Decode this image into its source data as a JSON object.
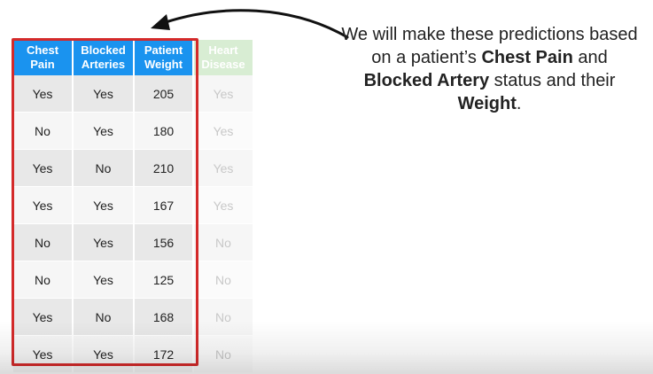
{
  "table": {
    "headers": [
      {
        "text": "Chest\nPain"
      },
      {
        "text": "Blocked\nArteries"
      },
      {
        "text": "Patient\nWeight"
      },
      {
        "text": "Heart\nDisease"
      }
    ],
    "rows": [
      [
        "Yes",
        "Yes",
        "205",
        "Yes"
      ],
      [
        "No",
        "Yes",
        "180",
        "Yes"
      ],
      [
        "Yes",
        "No",
        "210",
        "Yes"
      ],
      [
        "Yes",
        "Yes",
        "167",
        "Yes"
      ],
      [
        "No",
        "Yes",
        "156",
        "No"
      ],
      [
        "No",
        "Yes",
        "125",
        "No"
      ],
      [
        "Yes",
        "No",
        "168",
        "No"
      ],
      [
        "Yes",
        "Yes",
        "172",
        "No"
      ]
    ]
  },
  "caption": {
    "p1": "We will make these predictions based on a patient’s ",
    "b1": "Chest Pain",
    "p2": " and ",
    "b2": "Blocked Artery",
    "p3": " status and their ",
    "b3": "Weight",
    "p4": "."
  },
  "colors": {
    "header_blue": "#1a93ef",
    "header_faded_green": "#d8edd3",
    "highlight_red": "#d42a2a"
  }
}
